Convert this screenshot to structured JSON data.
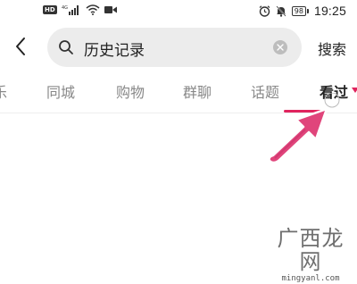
{
  "status_bar": {
    "hd_label": "HD",
    "network_label": "4G",
    "battery": "98",
    "time": "19:25",
    "icons": [
      "hd-icon",
      "signal-icon",
      "wifi-icon",
      "video-icon",
      "alarm-icon",
      "mute-icon",
      "battery-icon"
    ]
  },
  "search": {
    "query": "历史记录",
    "button_label": "搜索",
    "icons": [
      "back-icon",
      "search-icon",
      "clear-icon"
    ]
  },
  "tabs": [
    {
      "label": "乐",
      "active": false
    },
    {
      "label": "同城",
      "active": false
    },
    {
      "label": "购物",
      "active": false
    },
    {
      "label": "群聊",
      "active": false
    },
    {
      "label": "话题",
      "active": false
    },
    {
      "label": "看过",
      "active": true
    }
  ],
  "annotation": {
    "type": "arrow",
    "color": "#e0457b"
  },
  "watermark": {
    "title": "广西龙网",
    "url": "mingyanl.com"
  },
  "colors": {
    "accent": "#e0245e",
    "search_bg": "#ececec",
    "tab_inactive": "#888888"
  }
}
